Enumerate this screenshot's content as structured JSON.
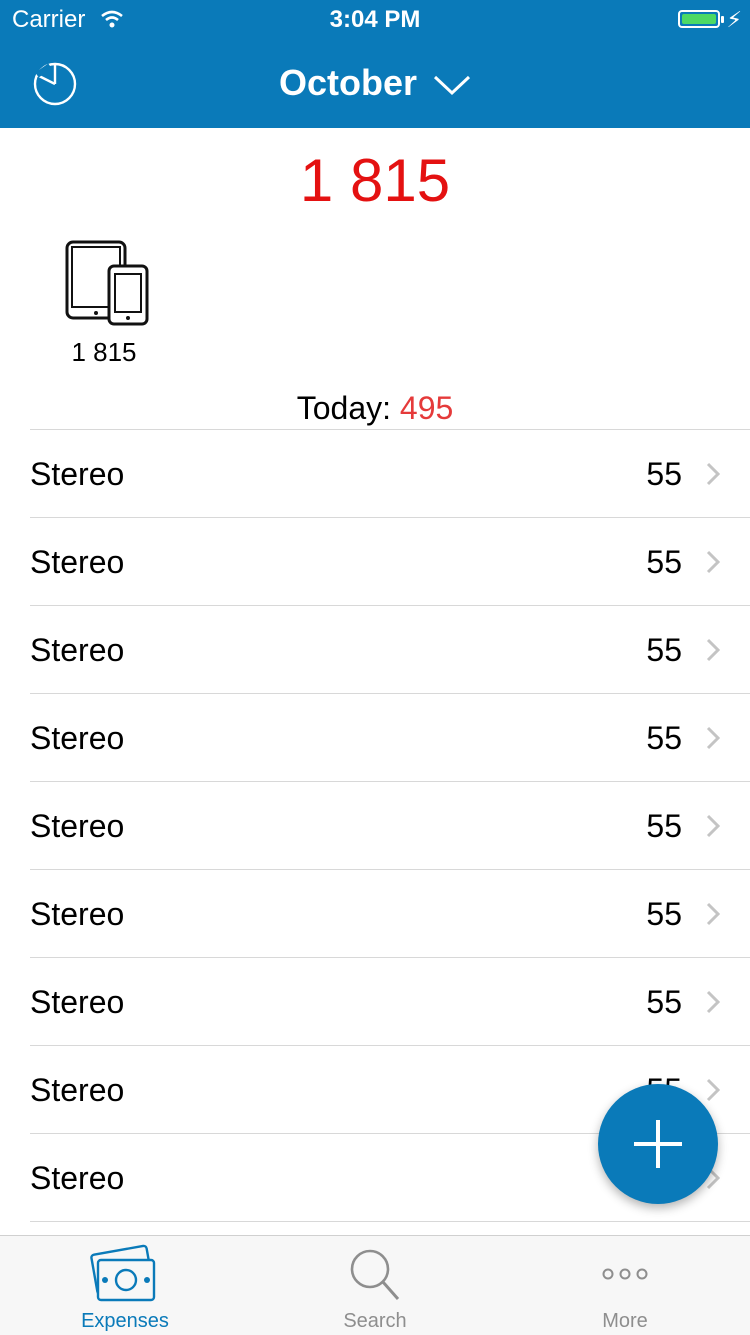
{
  "status_bar": {
    "carrier": "Carrier",
    "time": "3:04 PM"
  },
  "header": {
    "month": "October"
  },
  "summary": {
    "total": "1 815",
    "category_total": "1 815",
    "today_label": "Today: ",
    "today_value": "495"
  },
  "expenses": [
    {
      "name": "Stereo",
      "amount": "55"
    },
    {
      "name": "Stereo",
      "amount": "55"
    },
    {
      "name": "Stereo",
      "amount": "55"
    },
    {
      "name": "Stereo",
      "amount": "55"
    },
    {
      "name": "Stereo",
      "amount": "55"
    },
    {
      "name": "Stereo",
      "amount": "55"
    },
    {
      "name": "Stereo",
      "amount": "55"
    },
    {
      "name": "Stereo",
      "amount": "55"
    },
    {
      "name": "Stereo",
      "amount": ""
    }
  ],
  "tabs": [
    {
      "label": "Expenses",
      "icon": "money-icon",
      "active": true
    },
    {
      "label": "Search",
      "icon": "search-icon",
      "active": false
    },
    {
      "label": "More",
      "icon": "more-icon",
      "active": false
    }
  ],
  "colors": {
    "brand": "#0a7ab9",
    "total": "#e41111",
    "today": "#e53a3a"
  }
}
